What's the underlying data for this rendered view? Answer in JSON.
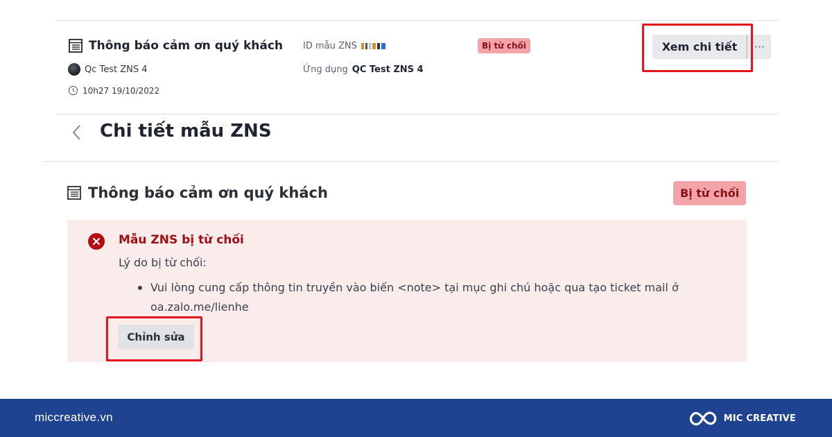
{
  "template_row": {
    "title": "Thông báo cảm ơn quý khách",
    "app_owner": "Qc Test ZNS 4",
    "timestamp": "10h27 19/10/2022",
    "template_id_label": "ID mẫu ZNS",
    "app_label": "Ứng dụng",
    "app_name": "QC Test ZNS 4",
    "status": "Bị từ chối",
    "view_button": "Xem chi tiết",
    "more_button": "···"
  },
  "detail": {
    "heading": "Chi tiết mẫu ZNS",
    "card_title": "Thông báo cảm ơn quý khách",
    "status": "Bị từ chối",
    "rejection": {
      "title": "Mẫu ZNS bị từ chối",
      "reason_label": "Lý do bị từ chối:",
      "reasons": [
        "Vui lòng cung cấp thông tin truyền vào biến <note> tại mục ghi chú hoặc qua tạo ticket mail ở oa.zalo.me/lienhe"
      ]
    },
    "edit_button": "Chỉnh sửa"
  },
  "footer": {
    "site": "miccreative.vn",
    "brand": "MIC CREATIVE"
  },
  "colors": {
    "status_bg": "#f2a4a8",
    "status_text": "#8a1016",
    "error_panel_bg": "#fbecec",
    "error_red": "#b40e14",
    "highlight_red": "#e3141b",
    "footer_bg": "#1f4390"
  },
  "icons": [
    "document-icon",
    "avatar",
    "clock-icon",
    "chevron-left-icon",
    "error-circle-icon",
    "brand-logo-icon"
  ]
}
